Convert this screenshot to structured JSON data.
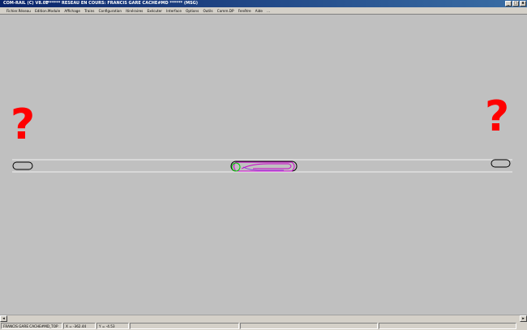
{
  "window": {
    "app_title": "COM-RAIL (C) V8.02",
    "document_title": "******* RESEAU EN COURS: FRANCIS GARE CACHE#MD ****** (MSG)",
    "minimize": "_",
    "maximize": "□",
    "close": "x"
  },
  "menu": {
    "items": [
      "Fichier.Réseau",
      "Edition.Module",
      "Affichage",
      "Trains",
      "Configuration",
      "Itinéraires",
      "Exécuter",
      "Interface",
      "Options",
      "Outils",
      "Comm.DP",
      "Fenêtre",
      "Aide",
      "..."
    ]
  },
  "canvas": {
    "left_marker": "?",
    "right_marker": "?",
    "colors": {
      "question": "#ff0000",
      "track": "#000000",
      "route": "#cc00cc",
      "route_start": "#00cc00"
    }
  },
  "statusbar": {
    "network": "FRANCIS GARE CACHE#MD_TOP",
    "x": "X = -362.44",
    "y": "Y = -4.53"
  }
}
